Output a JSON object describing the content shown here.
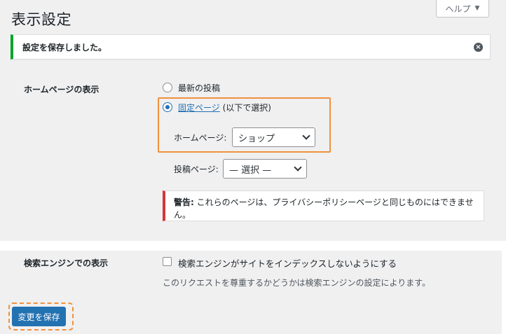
{
  "page": {
    "title": "表示設定"
  },
  "help_tab": {
    "label": "ヘルプ",
    "caret": "▼"
  },
  "notice": {
    "message": "設定を保存しました。",
    "dismiss_icon": "close-circle-icon",
    "dismiss_glyph": "×",
    "accent": "#00a32a"
  },
  "homepage_display": {
    "label": "ホームページの表示",
    "options": [
      {
        "label": "最新の投稿",
        "checked": false
      },
      {
        "link_label": "固定ページ",
        "suffix": "(以下で選択)",
        "checked": true
      }
    ],
    "homepage_select": {
      "label": "ホームページ:",
      "value": "ショップ"
    },
    "posts_select": {
      "label": "投稿ページ:",
      "value": "— 選択 —"
    },
    "warning": {
      "prefix": "警告:",
      "text": "これらのページは、プライバシーポリシーページと同じものにはできません。",
      "accent": "#d63638"
    }
  },
  "search_engine": {
    "label": "検索エンジンでの表示",
    "checkbox_label": "検索エンジンがサイトをインデックスしないようにする",
    "checked": false,
    "description": "このリクエストを尊重するかどうかは検索エンジンの設定によります。"
  },
  "save_button": {
    "label": "変更を保存",
    "color": "#2271b1"
  },
  "highlight_color": "#f0913b"
}
